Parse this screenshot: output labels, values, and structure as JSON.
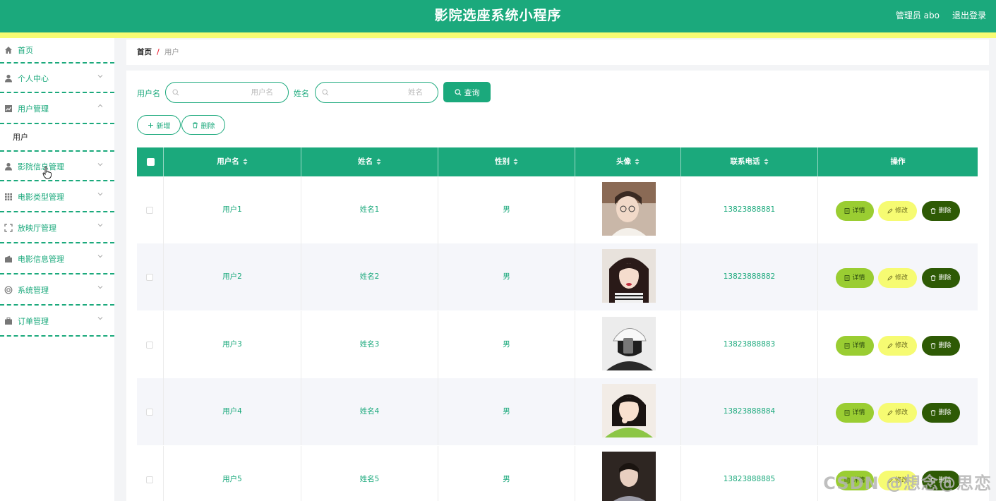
{
  "header": {
    "title": "影院选座系统小程序",
    "user": "管理员 abo",
    "logout": "退出登录"
  },
  "sidebar": {
    "home": "首页",
    "personal": "个人中心",
    "user_mgmt": "用户管理",
    "user_sub": "用户",
    "cinema_info": "影院信息管理",
    "movie_type": "电影类型管理",
    "hall": "放映厅管理",
    "movie_info": "电影信息管理",
    "system": "系统管理",
    "order": "订单管理"
  },
  "breadcrumb": {
    "home": "首页",
    "separator": "/",
    "current": "用户"
  },
  "search": {
    "username_label": "用户名",
    "username_placeholder": "用户名",
    "name_label": "姓名",
    "name_placeholder": "姓名",
    "query_button": "查询"
  },
  "actions": {
    "add": "新增",
    "delete": "删除"
  },
  "table": {
    "columns": [
      "用户名",
      "姓名",
      "性别",
      "头像",
      "联系电话",
      "操作"
    ],
    "rows": [
      {
        "username": "用户1",
        "name": "姓名1",
        "gender": "男",
        "phone": "13823888881"
      },
      {
        "username": "用户2",
        "name": "姓名2",
        "gender": "男",
        "phone": "13823888882"
      },
      {
        "username": "用户3",
        "name": "姓名3",
        "gender": "男",
        "phone": "13823888883"
      },
      {
        "username": "用户4",
        "name": "姓名4",
        "gender": "男",
        "phone": "13823888884"
      },
      {
        "username": "用户5",
        "name": "姓名5",
        "gender": "男",
        "phone": "13823888885"
      }
    ],
    "row_actions": {
      "detail": "详情",
      "edit": "修改",
      "delete": "删除"
    }
  },
  "watermark": "CSDN @想念@思恋",
  "colors": {
    "primary": "#1ba97c",
    "accent_yellow": "#f6fb72",
    "detail_btn": "#9acd32",
    "delete_btn": "#2e5a05"
  }
}
